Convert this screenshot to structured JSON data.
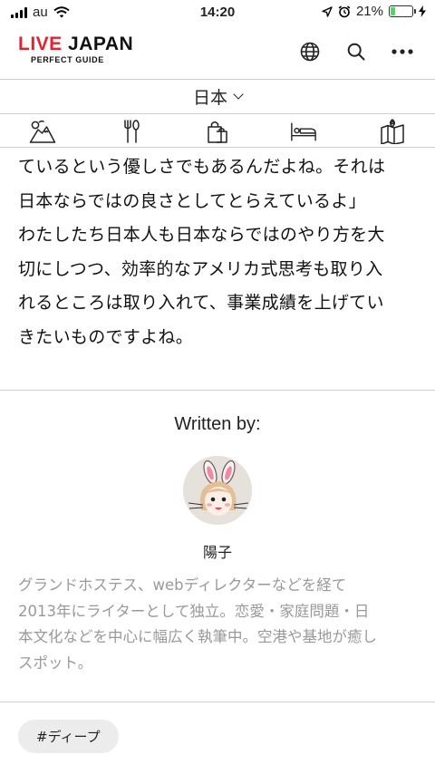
{
  "status_bar": {
    "carrier": "au",
    "time": "14:20",
    "battery_percent": "21%",
    "battery_level": 0.21,
    "icons": [
      "signal-icon",
      "wifi-icon",
      "location-arrow-icon",
      "alarm-icon",
      "battery-icon",
      "charging-icon"
    ]
  },
  "header": {
    "logo": {
      "part1": "LIVE",
      "part2": "JAPAN",
      "subtitle": "PERFECT GUIDE"
    },
    "icons": [
      "globe-icon",
      "search-icon",
      "more-icon"
    ]
  },
  "region": {
    "label": "日本"
  },
  "categories": [
    "sightseeing-icon",
    "dining-icon",
    "shopping-icon",
    "hotel-icon",
    "map-icon"
  ],
  "article": {
    "lines": [
      "ているという優しさでもあるんだよね。それは",
      "日本ならではの良さとしてとらえているよ」",
      "わたしたち日本人も日本ならではのやり方を大",
      "切にしつつ、効率的なアメリカ式思考も取り入",
      "れるところは取り入れて、事業成績を上げてい",
      "きたいものですよね。"
    ]
  },
  "author": {
    "written_by": "Written by:",
    "name": "陽子",
    "bio_lines": [
      "グランドホステス、webディレクターなどを経て",
      "2013年にライターとして独立。恋愛・家庭問題・日",
      "本文化などを中心に幅広く執筆中。空港や基地が癒し",
      "スポット。"
    ]
  },
  "tags": [
    "#ディープ"
  ],
  "colors": {
    "brand_red": "#e2222d",
    "battery_green": "#4cd964",
    "bio_gray": "#999999",
    "divider": "#cccccc"
  }
}
